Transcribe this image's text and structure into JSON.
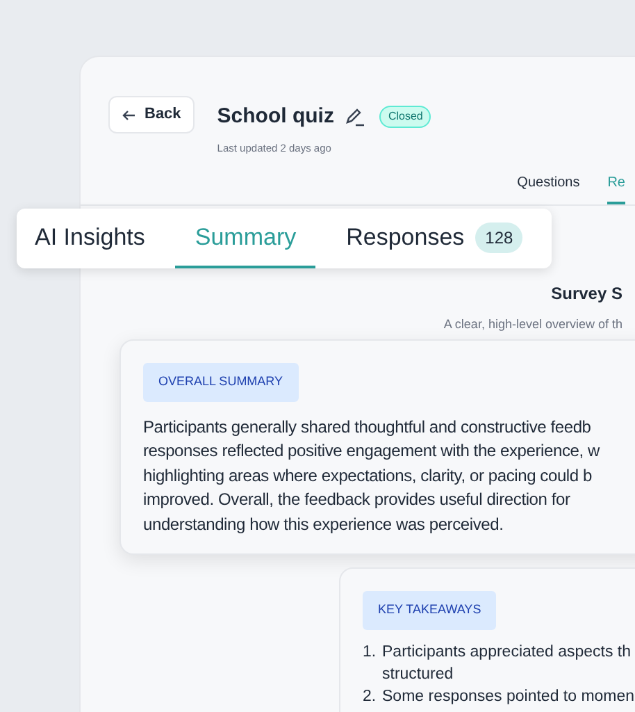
{
  "header": {
    "back": "Back",
    "title": "School quiz",
    "status": "Closed",
    "updated": "Last updated 2 days ago"
  },
  "page_tabs": [
    {
      "label": "Questions",
      "selected": false
    },
    {
      "label": "Re",
      "selected": true
    }
  ],
  "insight_tabs": [
    {
      "label": "AI Insights",
      "selected": false
    },
    {
      "label": "Summary",
      "selected": true
    },
    {
      "label": "Responses",
      "selected": false,
      "count": "128"
    }
  ],
  "section": {
    "title": "Survey S",
    "subtitle": "A clear, high-level overview of th"
  },
  "summary": {
    "tag": "OVERALL SUMMARY",
    "lines": [
      "Participants generally shared thoughtful and constructive feedb",
      "responses reflected positive engagement with the experience, w",
      "highlighting areas where expectations, clarity, or pacing could b",
      "improved. Overall, the feedback provides useful direction for",
      "understanding how this experience was perceived."
    ]
  },
  "takeaways": {
    "tag": "KEY TAKEAWAYS",
    "items": [
      {
        "number": "1.",
        "lines": [
          "Participants appreciated aspects th",
          "structured"
        ]
      },
      {
        "number": "2.",
        "lines": [
          "Some responses pointed to momen"
        ]
      }
    ]
  }
}
